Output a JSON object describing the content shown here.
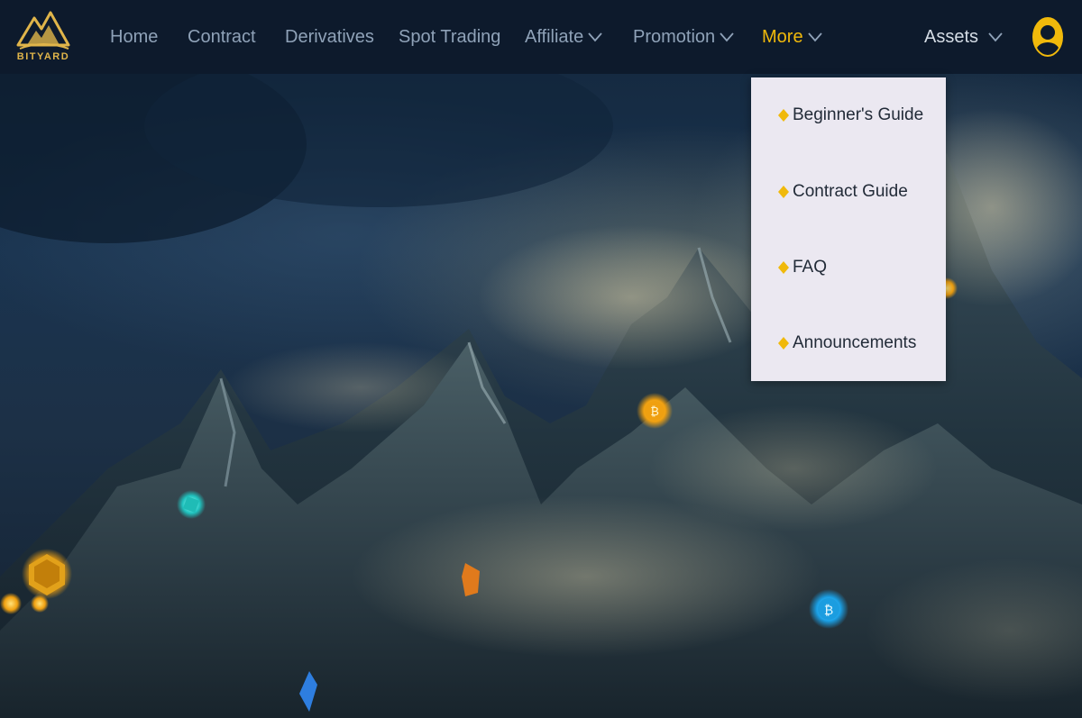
{
  "brand": {
    "name": "BITYARD",
    "accent": "#f0b90b"
  },
  "nav": {
    "items": [
      {
        "label": "Home"
      },
      {
        "label": "Contract"
      },
      {
        "label": "Derivatives"
      },
      {
        "label": "Spot Trading"
      },
      {
        "label": "Affiliate",
        "has_dropdown": true
      },
      {
        "label": "Promotion",
        "has_dropdown": true
      },
      {
        "label": "More",
        "has_dropdown": true,
        "active": true
      }
    ],
    "assets_label": "Assets",
    "user_icon": "user-icon"
  },
  "more_menu": {
    "items": [
      {
        "label": "Beginner's Guide"
      },
      {
        "label": "Contract Guide"
      },
      {
        "label": "FAQ"
      },
      {
        "label": "Announcements"
      }
    ]
  },
  "colors": {
    "nav_bg": "#0d1a2c",
    "nav_text": "#8fa2b8",
    "dropdown_bg": "#ebe8f1"
  }
}
